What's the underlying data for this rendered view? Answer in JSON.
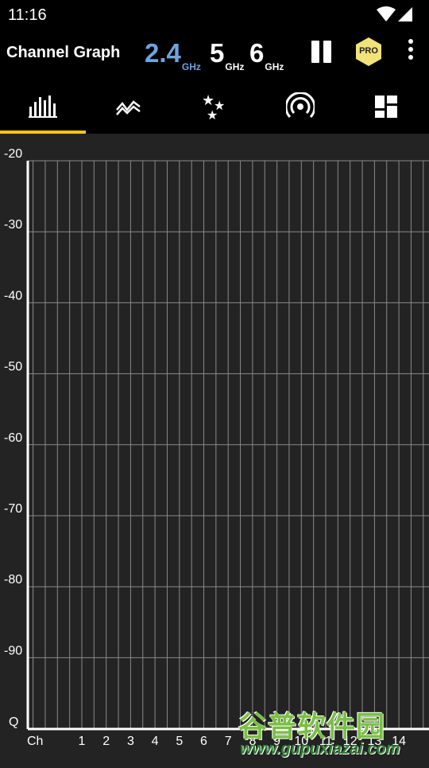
{
  "status_bar": {
    "time": "11:16"
  },
  "app_bar": {
    "title": "Channel Graph",
    "bands": [
      {
        "value": "2.4",
        "unit": "GHz",
        "active": true
      },
      {
        "value": "5",
        "unit": "GHz",
        "active": false
      },
      {
        "value": "6",
        "unit": "GHz",
        "active": false
      }
    ],
    "pro_label": "PRO",
    "accent_color": "#6fa4df",
    "pro_color": "#f2e27a"
  },
  "tabs": [
    {
      "icon": "bar-chart-icon",
      "selected": true
    },
    {
      "icon": "time-graph-icon",
      "selected": false
    },
    {
      "icon": "stars-rating-icon",
      "selected": false
    },
    {
      "icon": "access-point-icon",
      "selected": false
    },
    {
      "icon": "dashboard-icon",
      "selected": false
    }
  ],
  "tab_indicator_color": "#f5c518",
  "chart_data": {
    "type": "bar",
    "y_ticks": [
      "-20",
      "-30",
      "-40",
      "-50",
      "-60",
      "-70",
      "-80",
      "-90"
    ],
    "y_bottom_label": "Q",
    "x_label": "Ch",
    "categories": [
      "1",
      "2",
      "3",
      "4",
      "5",
      "6",
      "7",
      "8",
      "9",
      "10",
      "11",
      "12",
      "13",
      "14"
    ],
    "ylim": [
      -100,
      -20
    ],
    "series": [],
    "grid": true
  },
  "watermark": {
    "text": "谷普软件园",
    "url": "www.gupuxiazai.com"
  }
}
